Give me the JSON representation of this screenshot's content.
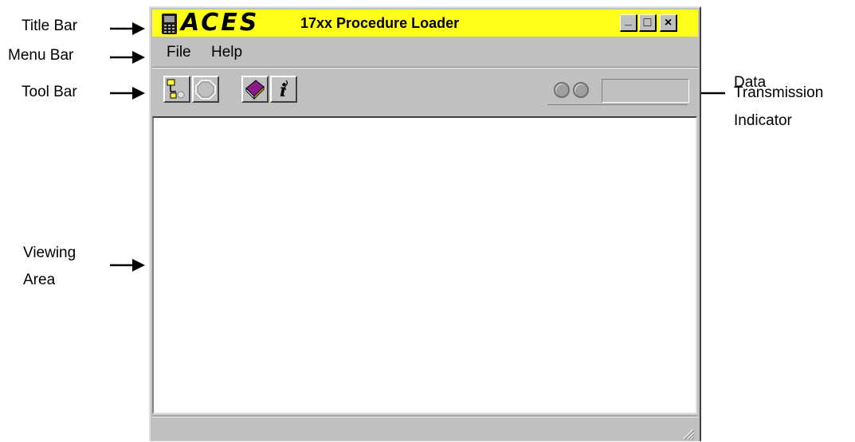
{
  "callouts": {
    "title_bar": "Title Bar",
    "menu_bar": "Menu Bar",
    "tool_bar": "Tool Bar",
    "viewing_area_line1": "Viewing",
    "viewing_area_line2": "Area",
    "data_line1": "Data",
    "data_line2": "Transmission",
    "data_line3": "Indicator"
  },
  "window": {
    "logo": "ACES",
    "title": "17xx Procedure Loader",
    "controls": {
      "minimize": "_",
      "maximize": "□",
      "close": "×"
    }
  },
  "menu": [
    "File",
    "Help"
  ],
  "toolbar_icons": [
    "connect-icon",
    "stop-icon",
    "book-icon",
    "info-icon"
  ],
  "colors": {
    "title_bar": "#ffff1a",
    "window_bg": "#c0c0c0",
    "book": "#8b1a8b"
  }
}
